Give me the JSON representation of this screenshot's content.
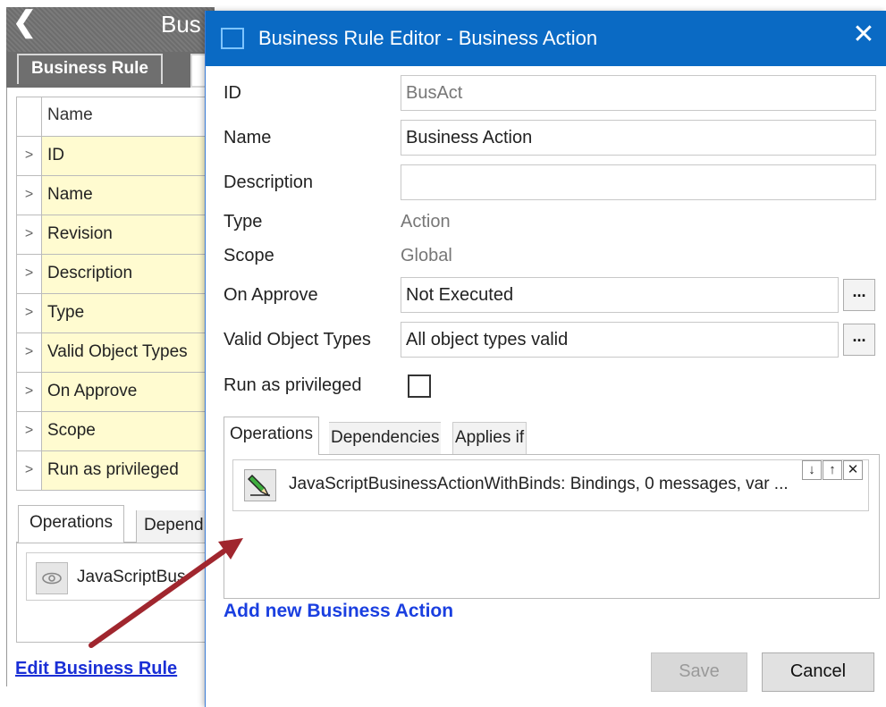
{
  "background": {
    "back_icon": "chevron-left-icon",
    "title_partial": "Bus",
    "tab_label": "Business Rule",
    "table_header": "Name",
    "rows": [
      "ID",
      "Name",
      "Revision",
      "Description",
      "Type",
      "Valid Object Types",
      "On Approve",
      "Scope",
      "Run as privileged"
    ],
    "tabs": {
      "operations": "Operations",
      "dependencies_partial": "Depend"
    },
    "operation_text_partial": "JavaScriptBus",
    "edit_link": "Edit Business Rule"
  },
  "dialog": {
    "title": "Business Rule Editor - Business Action",
    "close_icon": "close-icon",
    "fields": {
      "id": {
        "label": "ID",
        "value": "BusAct"
      },
      "name": {
        "label": "Name",
        "value": "Business Action"
      },
      "description": {
        "label": "Description",
        "value": ""
      },
      "type": {
        "label": "Type",
        "value": "Action"
      },
      "scope": {
        "label": "Scope",
        "value": "Global"
      },
      "on_approve": {
        "label": "On Approve",
        "value": "Not Executed",
        "button": "..."
      },
      "valid_object_types": {
        "label": "Valid Object Types",
        "value": "All object types valid",
        "button": "..."
      },
      "run_as_privileged": {
        "label": "Run as privileged",
        "checked": false
      }
    },
    "tabs": [
      "Operations",
      "Dependencies",
      "Applies if"
    ],
    "operation": {
      "icon": "edit-script-icon",
      "text": "JavaScriptBusinessActionWithBinds: Bindings, 0 messages, var ...",
      "controls": [
        "↓",
        "↑",
        "✕"
      ]
    },
    "add_link": "Add new Business Action",
    "buttons": {
      "save": "Save",
      "cancel": "Cancel"
    }
  },
  "colors": {
    "titlebar": "#0a6ac4",
    "link": "#1a3fe0",
    "highlight_row": "#fffbd0",
    "annotation_arrow": "#a0262e"
  }
}
